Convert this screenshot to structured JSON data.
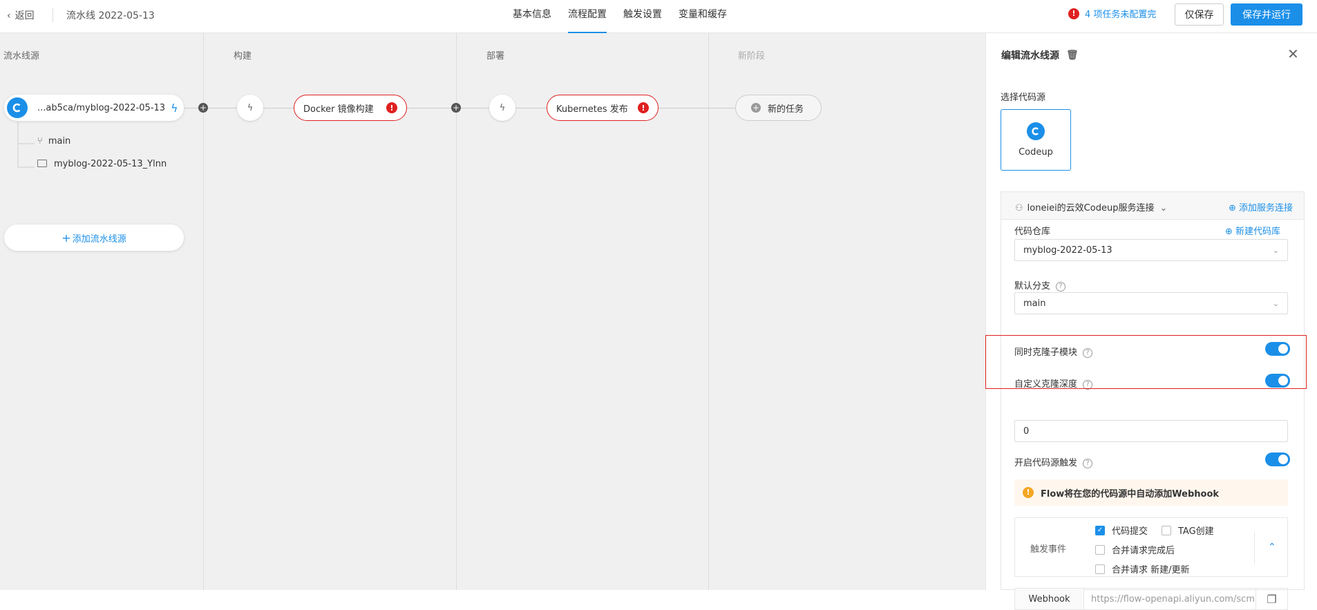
{
  "header": {
    "back_label": "返回",
    "pipeline_title": "流水线 2022-05-13",
    "tabs": [
      {
        "label": "基本信息"
      },
      {
        "label": "流程配置",
        "active": true
      },
      {
        "label": "触发设置"
      },
      {
        "label": "变量和缓存"
      }
    ],
    "warning_text": "4 项任务未配置完",
    "save_label": "仅保存",
    "save_run_label": "保存并运行"
  },
  "canvas": {
    "stages": [
      {
        "label": "流水线源"
      },
      {
        "label": "构建"
      },
      {
        "label": "部署"
      },
      {
        "label": "新阶段"
      }
    ],
    "source": {
      "name": "...ab5ca/myblog-2022-05-13",
      "branch": "main",
      "repo_dir": "myblog-2022-05-13_Ylnn",
      "add_label": "添加流水线源"
    },
    "jobs": [
      {
        "name": "Docker 镜像构建"
      },
      {
        "name": "Kubernetes 发布"
      }
    ],
    "new_job_label": "新的任务"
  },
  "panel": {
    "title": "编辑流水线源",
    "select_source_label": "选择代码源",
    "source_option": "Codeup",
    "connection_label": "loneiei的云效Codeup服务连接",
    "add_connection_label": "添加服务连接",
    "repo_label": "代码仓库",
    "new_repo_label": "新建代码库",
    "repo_value": "myblog-2022-05-13",
    "branch_label": "默认分支",
    "branch_value": "main",
    "clone_submodules_label": "同时克隆子模块",
    "clone_depth_label": "自定义克隆深度",
    "clone_depth_value": "0",
    "enable_trigger_label": "开启代码源触发",
    "notice": "Flow将在您的代码源中自动添加Webhook",
    "events_label": "触发事件",
    "events": [
      {
        "label": "代码提交",
        "checked": true
      },
      {
        "label": "TAG创建",
        "checked": false
      },
      {
        "label": "合并请求完成后",
        "checked": false
      },
      {
        "label": "合并请求 新建/更新",
        "checked": false
      }
    ],
    "webhook_label": "Webhook",
    "webhook_url": "https://flow-openapi.aliyun.com/scm"
  },
  "colors": {
    "accent": "#1b8fe8",
    "error": "#e02020",
    "warning": "#f5a623"
  }
}
